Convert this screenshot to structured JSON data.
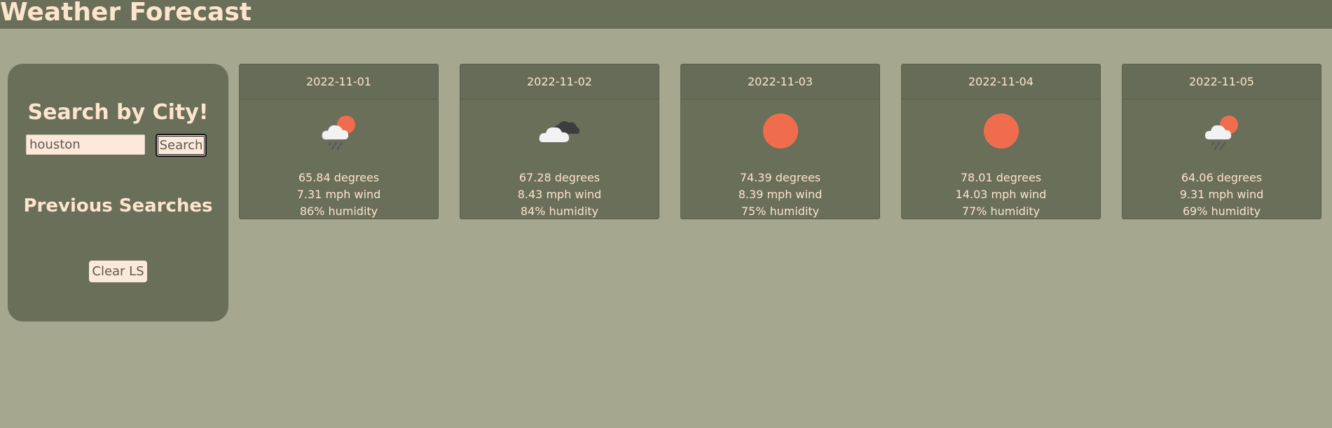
{
  "header": {
    "title": "Weather Forecast"
  },
  "sidebar": {
    "title": "Search by City!",
    "search": {
      "value": "houston",
      "placeholder": ""
    },
    "search_button": "Search",
    "previous_title": "Previous Searches",
    "clear_button": "Clear LS"
  },
  "colors": {
    "background": "#a5a78e",
    "panel": "#6a6f5a",
    "text": "#fde4cc",
    "sun": "#ef6d4d"
  },
  "forecast": [
    {
      "date": "2022-11-01",
      "icon": "sun-rain-icon",
      "temp": "65.84 degrees",
      "wind": "7.31 mph wind",
      "humidity": "86% humidity"
    },
    {
      "date": "2022-11-02",
      "icon": "broken-clouds-icon",
      "temp": "67.28 degrees",
      "wind": "8.43 mph wind",
      "humidity": "84% humidity"
    },
    {
      "date": "2022-11-03",
      "icon": "clear-sun-icon",
      "temp": "74.39 degrees",
      "wind": "8.39 mph wind",
      "humidity": "75% humidity"
    },
    {
      "date": "2022-11-04",
      "icon": "clear-sun-icon",
      "temp": "78.01 degrees",
      "wind": "14.03 mph wind",
      "humidity": "77% humidity"
    },
    {
      "date": "2022-11-05",
      "icon": "sun-rain-icon",
      "temp": "64.06 degrees",
      "wind": "9.31 mph wind",
      "humidity": "69% humidity"
    }
  ]
}
